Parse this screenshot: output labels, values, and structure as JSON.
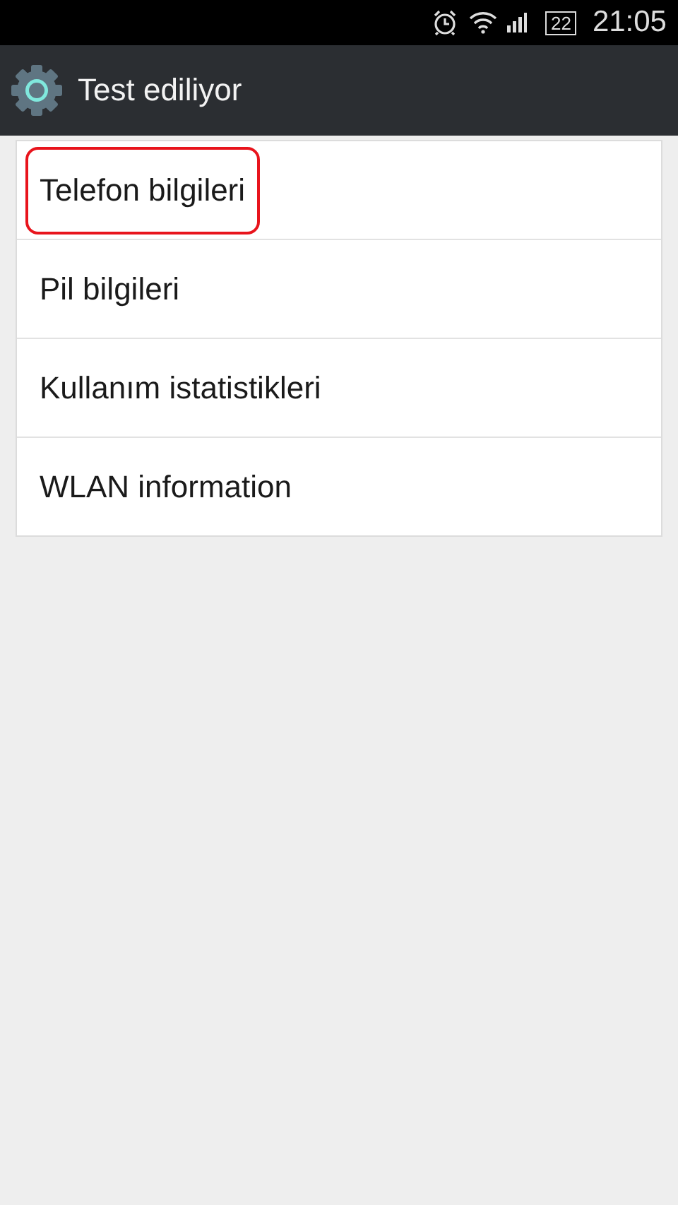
{
  "status_bar": {
    "battery": "22",
    "time": "21:05"
  },
  "app_bar": {
    "title": "Test ediliyor"
  },
  "items": [
    {
      "label": "Telefon bilgileri",
      "highlighted": true
    },
    {
      "label": "Pil bilgileri",
      "highlighted": false
    },
    {
      "label": "Kullanım istatistikleri",
      "highlighted": false
    },
    {
      "label": "WLAN information",
      "highlighted": false
    }
  ]
}
